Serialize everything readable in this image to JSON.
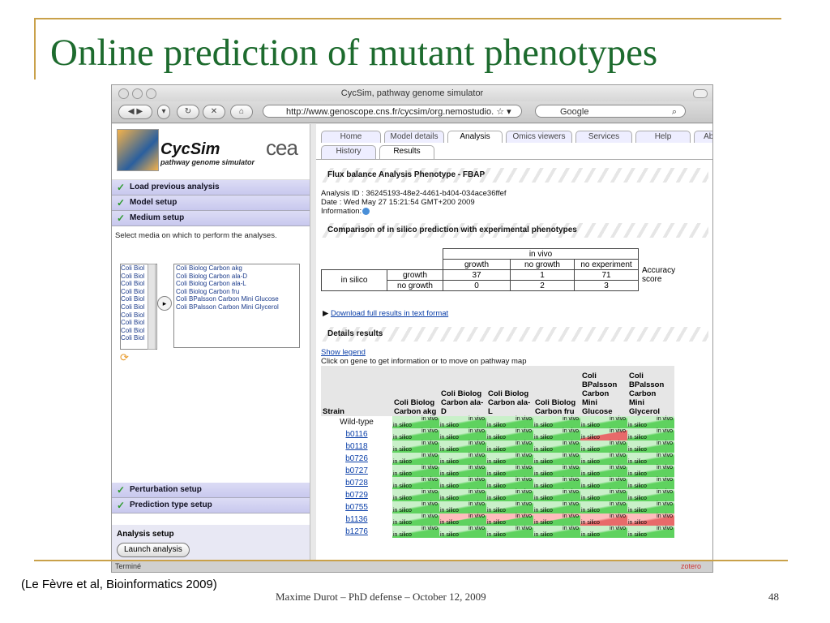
{
  "slide": {
    "title": "Online prediction of mutant phenotypes",
    "citation": "(Le Fèvre et al, Bioinformatics 2009)",
    "footer": "Maxime Durot – PhD defense – October 12, 2009",
    "page_number": "48"
  },
  "browser": {
    "window_title": "CycSim, pathway genome simulator",
    "url": "http://www.genoscope.cns.fr/cycsim/org.nemostudio.",
    "search_placeholder": "Google",
    "status_text": "Terminé",
    "status_right": "zotero"
  },
  "sidebar": {
    "logo_name": "CycSim",
    "logo_subtitle": "pathway genome simulator",
    "logo_partner": "cea",
    "sections": [
      {
        "label": "Load previous analysis"
      },
      {
        "label": "Model setup"
      },
      {
        "label": "Medium setup"
      }
    ],
    "medium_instructions": "Select media on which to perform the analyses.",
    "available_media": [
      "Coli Biol",
      "Coli Biol",
      "Coli Biol",
      "Coli Biol",
      "Coli Biol",
      "Coli Biol",
      "Coli Biol",
      "Coli Biol",
      "Coli Biol",
      "Coli Biol"
    ],
    "selected_media": [
      "Coli Biolog Carbon akg",
      "Coli Biolog Carbon ala-D",
      "Coli Biolog Carbon ala-L",
      "Coli Biolog Carbon fru",
      "Coli BPalsson Carbon Mini Glucose",
      "Coli BPalsson Carbon Mini Glycerol"
    ],
    "lower_sections": [
      {
        "label": "Perturbation setup"
      },
      {
        "label": "Prediction type setup"
      }
    ],
    "analysis_setup_label": "Analysis setup",
    "launch_button": "Launch analysis"
  },
  "tabs": {
    "main": [
      "Home",
      "Model details",
      "Analysis",
      "Omics viewers",
      "Services",
      "Help",
      "Abo"
    ],
    "sub": [
      "History",
      "Results"
    ],
    "active_main": "Analysis",
    "active_sub": "Results"
  },
  "results": {
    "fbap_title": "Flux balance Analysis Phenotype - FBAP",
    "analysis_id": "Analysis ID : 36245193-48e2-4461-b404-034ace36ffef",
    "date": "Date : Wed May 27 15:21:54 GMT+200 2009",
    "information": "Information:",
    "comparison_title": "Comparison of in silico prediction with experimental phenotypes",
    "comparison": {
      "in_vivo_label": "in vivo",
      "in_silico_label": "in silico",
      "columns": [
        "growth",
        "no growth",
        "no experiment"
      ],
      "rows": [
        {
          "label": "growth",
          "values": [
            "37",
            "1",
            "71"
          ]
        },
        {
          "label": "no growth",
          "values": [
            "0",
            "2",
            "3"
          ]
        }
      ],
      "accuracy_label": "Accuracy score"
    },
    "download_link": "Download full results in text format",
    "details_title": "Details results",
    "show_legend": "Show legend",
    "click_hint": "Click on gene to get information or to move on pathway map",
    "details_columns": [
      "Strain",
      "Coli Biolog Carbon akg",
      "Coli Biolog Carbon ala-D",
      "Coli Biolog Carbon ala-L",
      "Coli Biolog Carbon fru",
      "Coli BPalsson Carbon Mini Glucose",
      "Coli BPalsson Carbon Mini Glycerol"
    ],
    "cell_top": "in vivo",
    "cell_bottom": "in silico",
    "strains": [
      {
        "name": "Wild-type",
        "cells": [
          "g",
          "g",
          "g",
          "g",
          "g",
          "g"
        ]
      },
      {
        "name": "b0116",
        "cells": [
          "g",
          "g",
          "g",
          "g",
          "rg",
          "g"
        ]
      },
      {
        "name": "b0118",
        "cells": [
          "g",
          "g",
          "g",
          "g",
          "g",
          "g"
        ]
      },
      {
        "name": "b0726",
        "cells": [
          "g",
          "g",
          "g",
          "g",
          "g",
          "g"
        ]
      },
      {
        "name": "b0727",
        "cells": [
          "g",
          "g",
          "g",
          "g",
          "g",
          "g"
        ]
      },
      {
        "name": "b0728",
        "cells": [
          "g",
          "g",
          "g",
          "g",
          "g",
          "g"
        ]
      },
      {
        "name": "b0729",
        "cells": [
          "g",
          "g",
          "g",
          "g",
          "g",
          "g"
        ]
      },
      {
        "name": "b0755",
        "cells": [
          "g",
          "g",
          "g",
          "g",
          "g",
          "g"
        ]
      },
      {
        "name": "b1136",
        "cells": [
          "g",
          "gr",
          "gr",
          "gr",
          "r",
          "r"
        ]
      },
      {
        "name": "b1276",
        "cells": [
          "g",
          "g",
          "g",
          "g",
          "g",
          "g"
        ]
      }
    ]
  }
}
